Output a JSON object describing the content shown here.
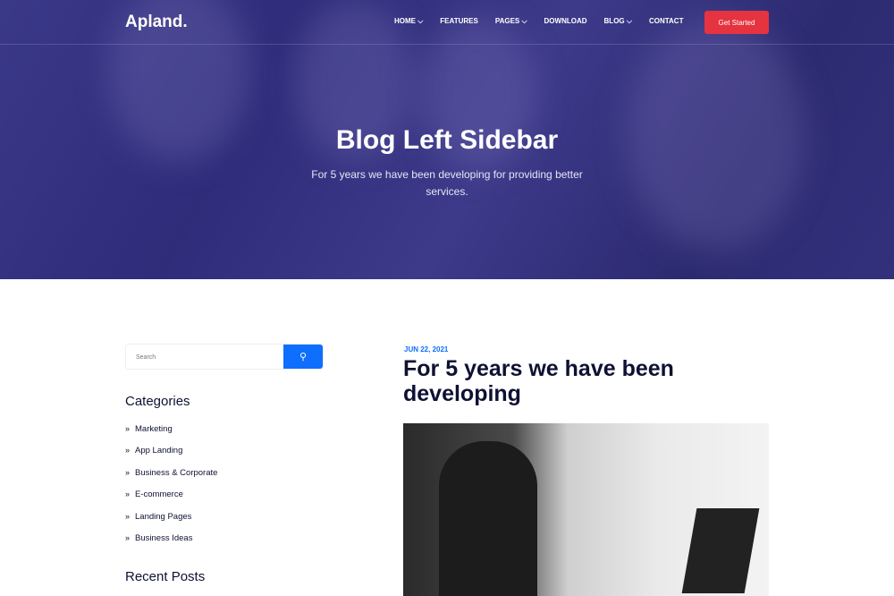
{
  "nav": {
    "logo": "Apland.",
    "items": [
      "HOME ⌵",
      "FEATURES",
      "PAGES ⌵",
      "DOWNLOAD",
      "BLOG ⌵",
      "CONTACT"
    ],
    "cta": "Get Started"
  },
  "hero": {
    "title": "Blog Left Sidebar",
    "subtitle": "For 5 years we have been developing for providing better services."
  },
  "sidebar": {
    "search_placeholder": "Search",
    "categories_title": "Categories",
    "categories": [
      "Marketing",
      "App Landing",
      "Business & Corporate",
      "E-commerce",
      "Landing Pages",
      "Business Ideas"
    ],
    "recent_title": "Recent Posts"
  },
  "post": {
    "date": "JUN 22, 2021",
    "title": "For 5 years we have been developing"
  }
}
